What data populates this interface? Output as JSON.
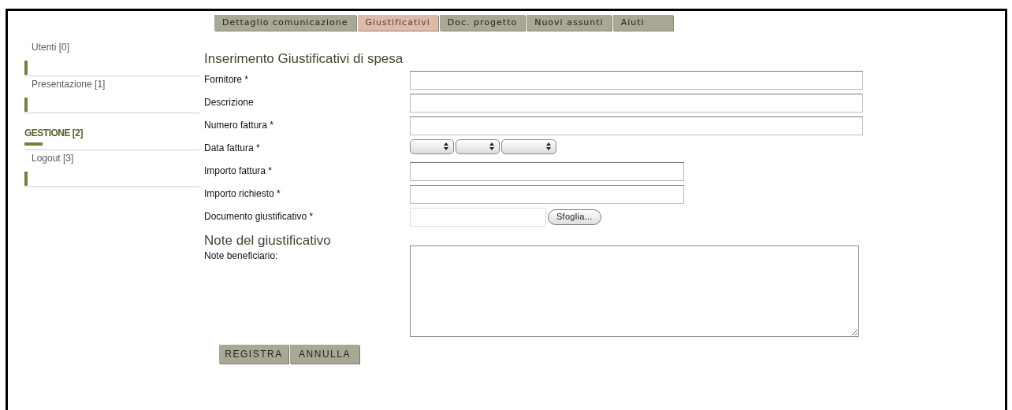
{
  "tabs": [
    {
      "label": "Dettaglio comunicazione",
      "selected": false
    },
    {
      "label": "Giustificativi",
      "selected": true
    },
    {
      "label": "Doc. progetto",
      "selected": false
    },
    {
      "label": "Nuovi assunti",
      "selected": false
    },
    {
      "label": "Aiuti",
      "selected": false
    }
  ],
  "sidebar": {
    "items": [
      {
        "label": "Utenti [0]",
        "selected": false
      },
      {
        "label": "Presentazione [1]",
        "selected": false
      },
      {
        "label": "GESTIONE [2]",
        "selected": true
      },
      {
        "label": "Logout [3]",
        "selected": false
      }
    ]
  },
  "form": {
    "title": "Inserimento Giustificativi di spesa",
    "fields": [
      {
        "label": "Fornitore *",
        "kind": "text"
      },
      {
        "label": "Descrizione",
        "kind": "text"
      },
      {
        "label": "Numero fattura *",
        "kind": "text"
      },
      {
        "label": "Data fattura *",
        "kind": "date"
      },
      {
        "label": "Importo fattura *",
        "kind": "short"
      },
      {
        "label": "Importo richiesto *",
        "kind": "short"
      },
      {
        "label": "Documento giustificativo *",
        "kind": "file",
        "button": "Sfoglia..."
      }
    ],
    "notes_title": "Note del giustificativo",
    "notes_label": "Note beneficiario:"
  },
  "buttons": [
    "REGISTRA",
    "ANNULLA"
  ]
}
